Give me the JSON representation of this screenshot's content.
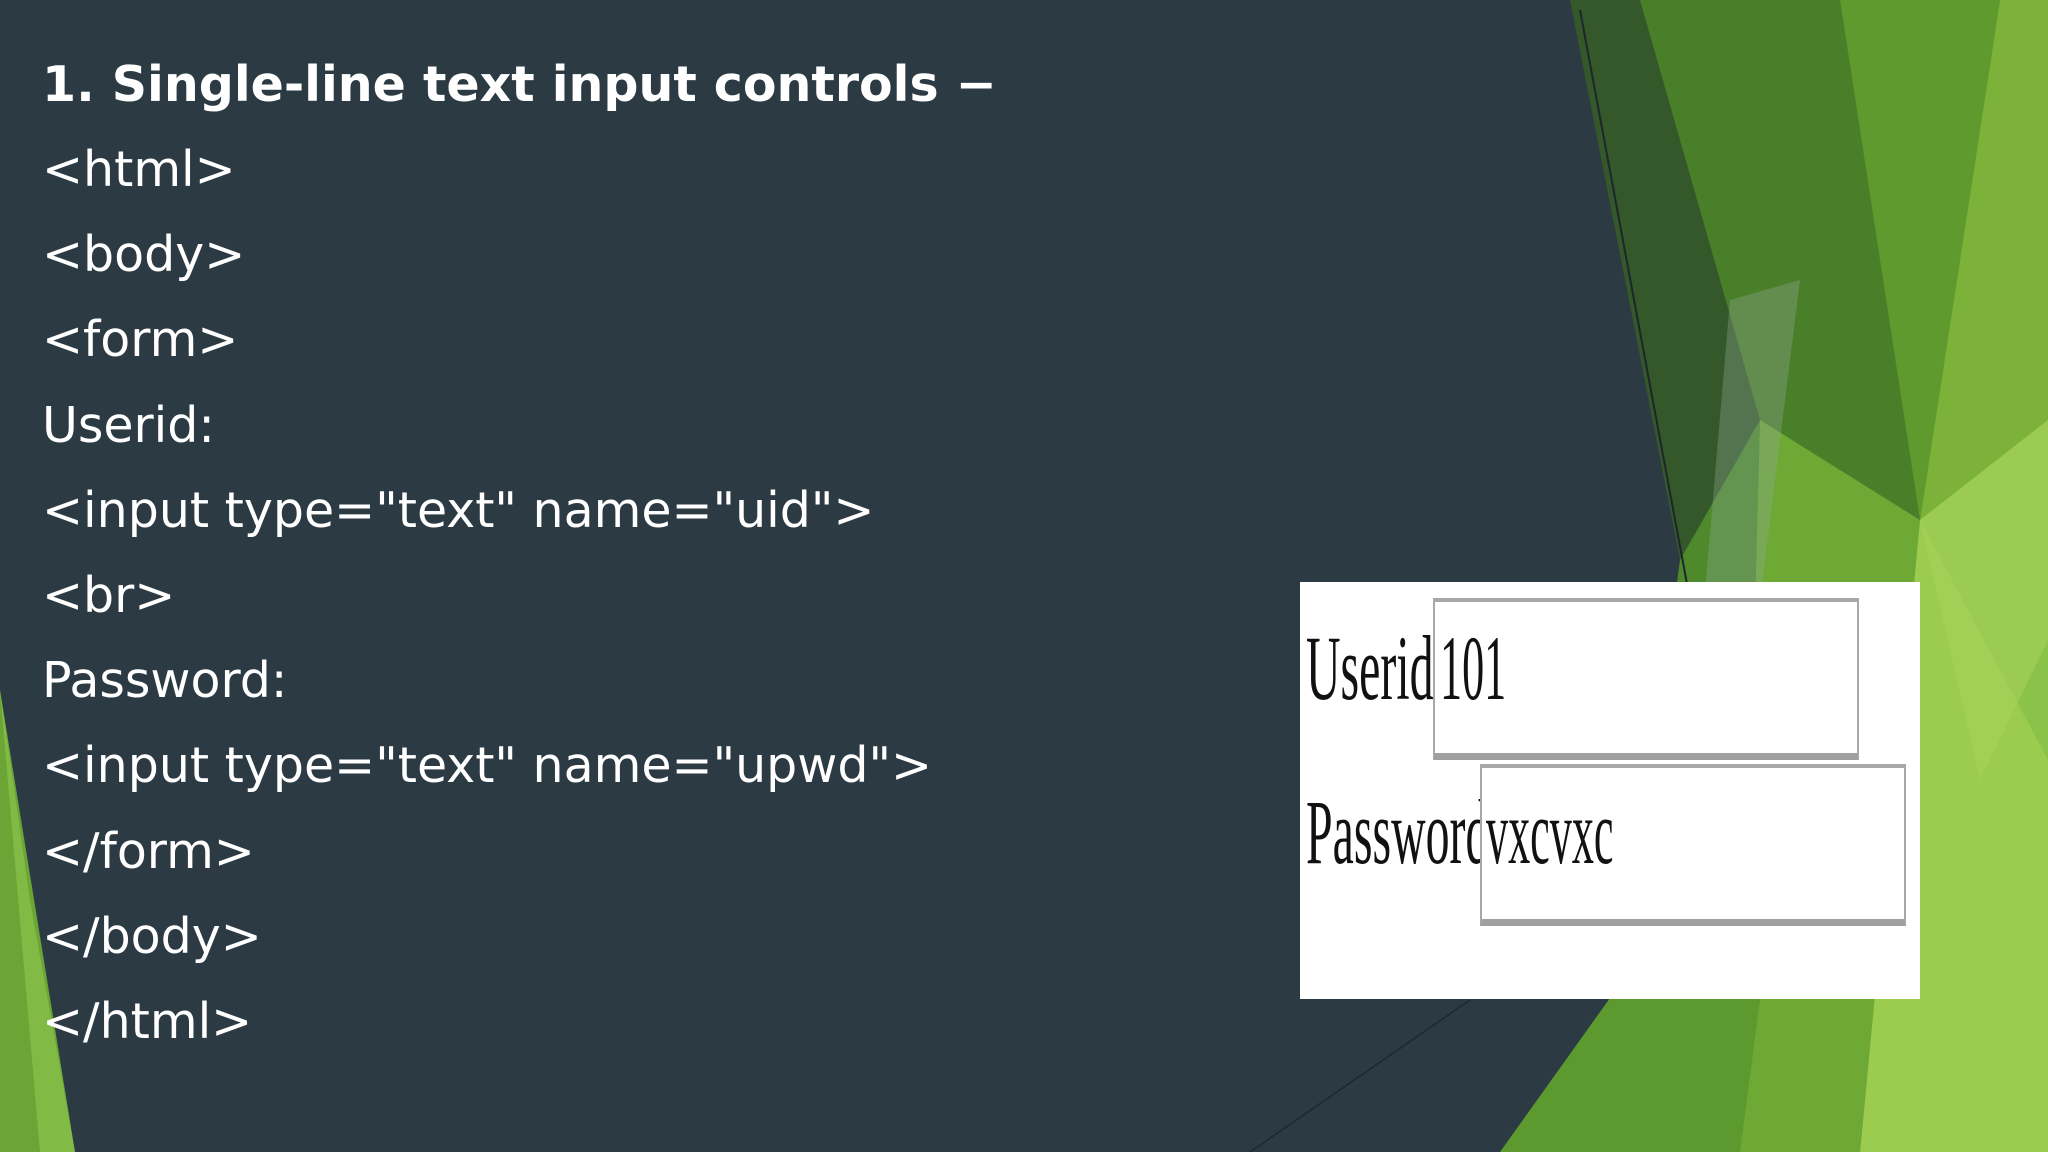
{
  "slide": {
    "title": "1. Single-line text input controls −",
    "code_lines": [
      "<html>",
      "<body>",
      "<form>",
      "Userid:",
      "<input type=\"text\" name=\"uid\">",
      "<br>",
      "Password:",
      "<input type=\"text\" name=\"upwd\">",
      "</form>",
      "</body>",
      "</html>"
    ]
  },
  "preview": {
    "userid_label": "Userid:",
    "userid_value": "101",
    "password_label": "Password:",
    "password_value": "vxcvxc"
  },
  "colors": {
    "background": "#2c3a43",
    "accent_light_green": "#8bc34a",
    "accent_dark_green": "#3e6b25",
    "text": "#ffffff"
  }
}
